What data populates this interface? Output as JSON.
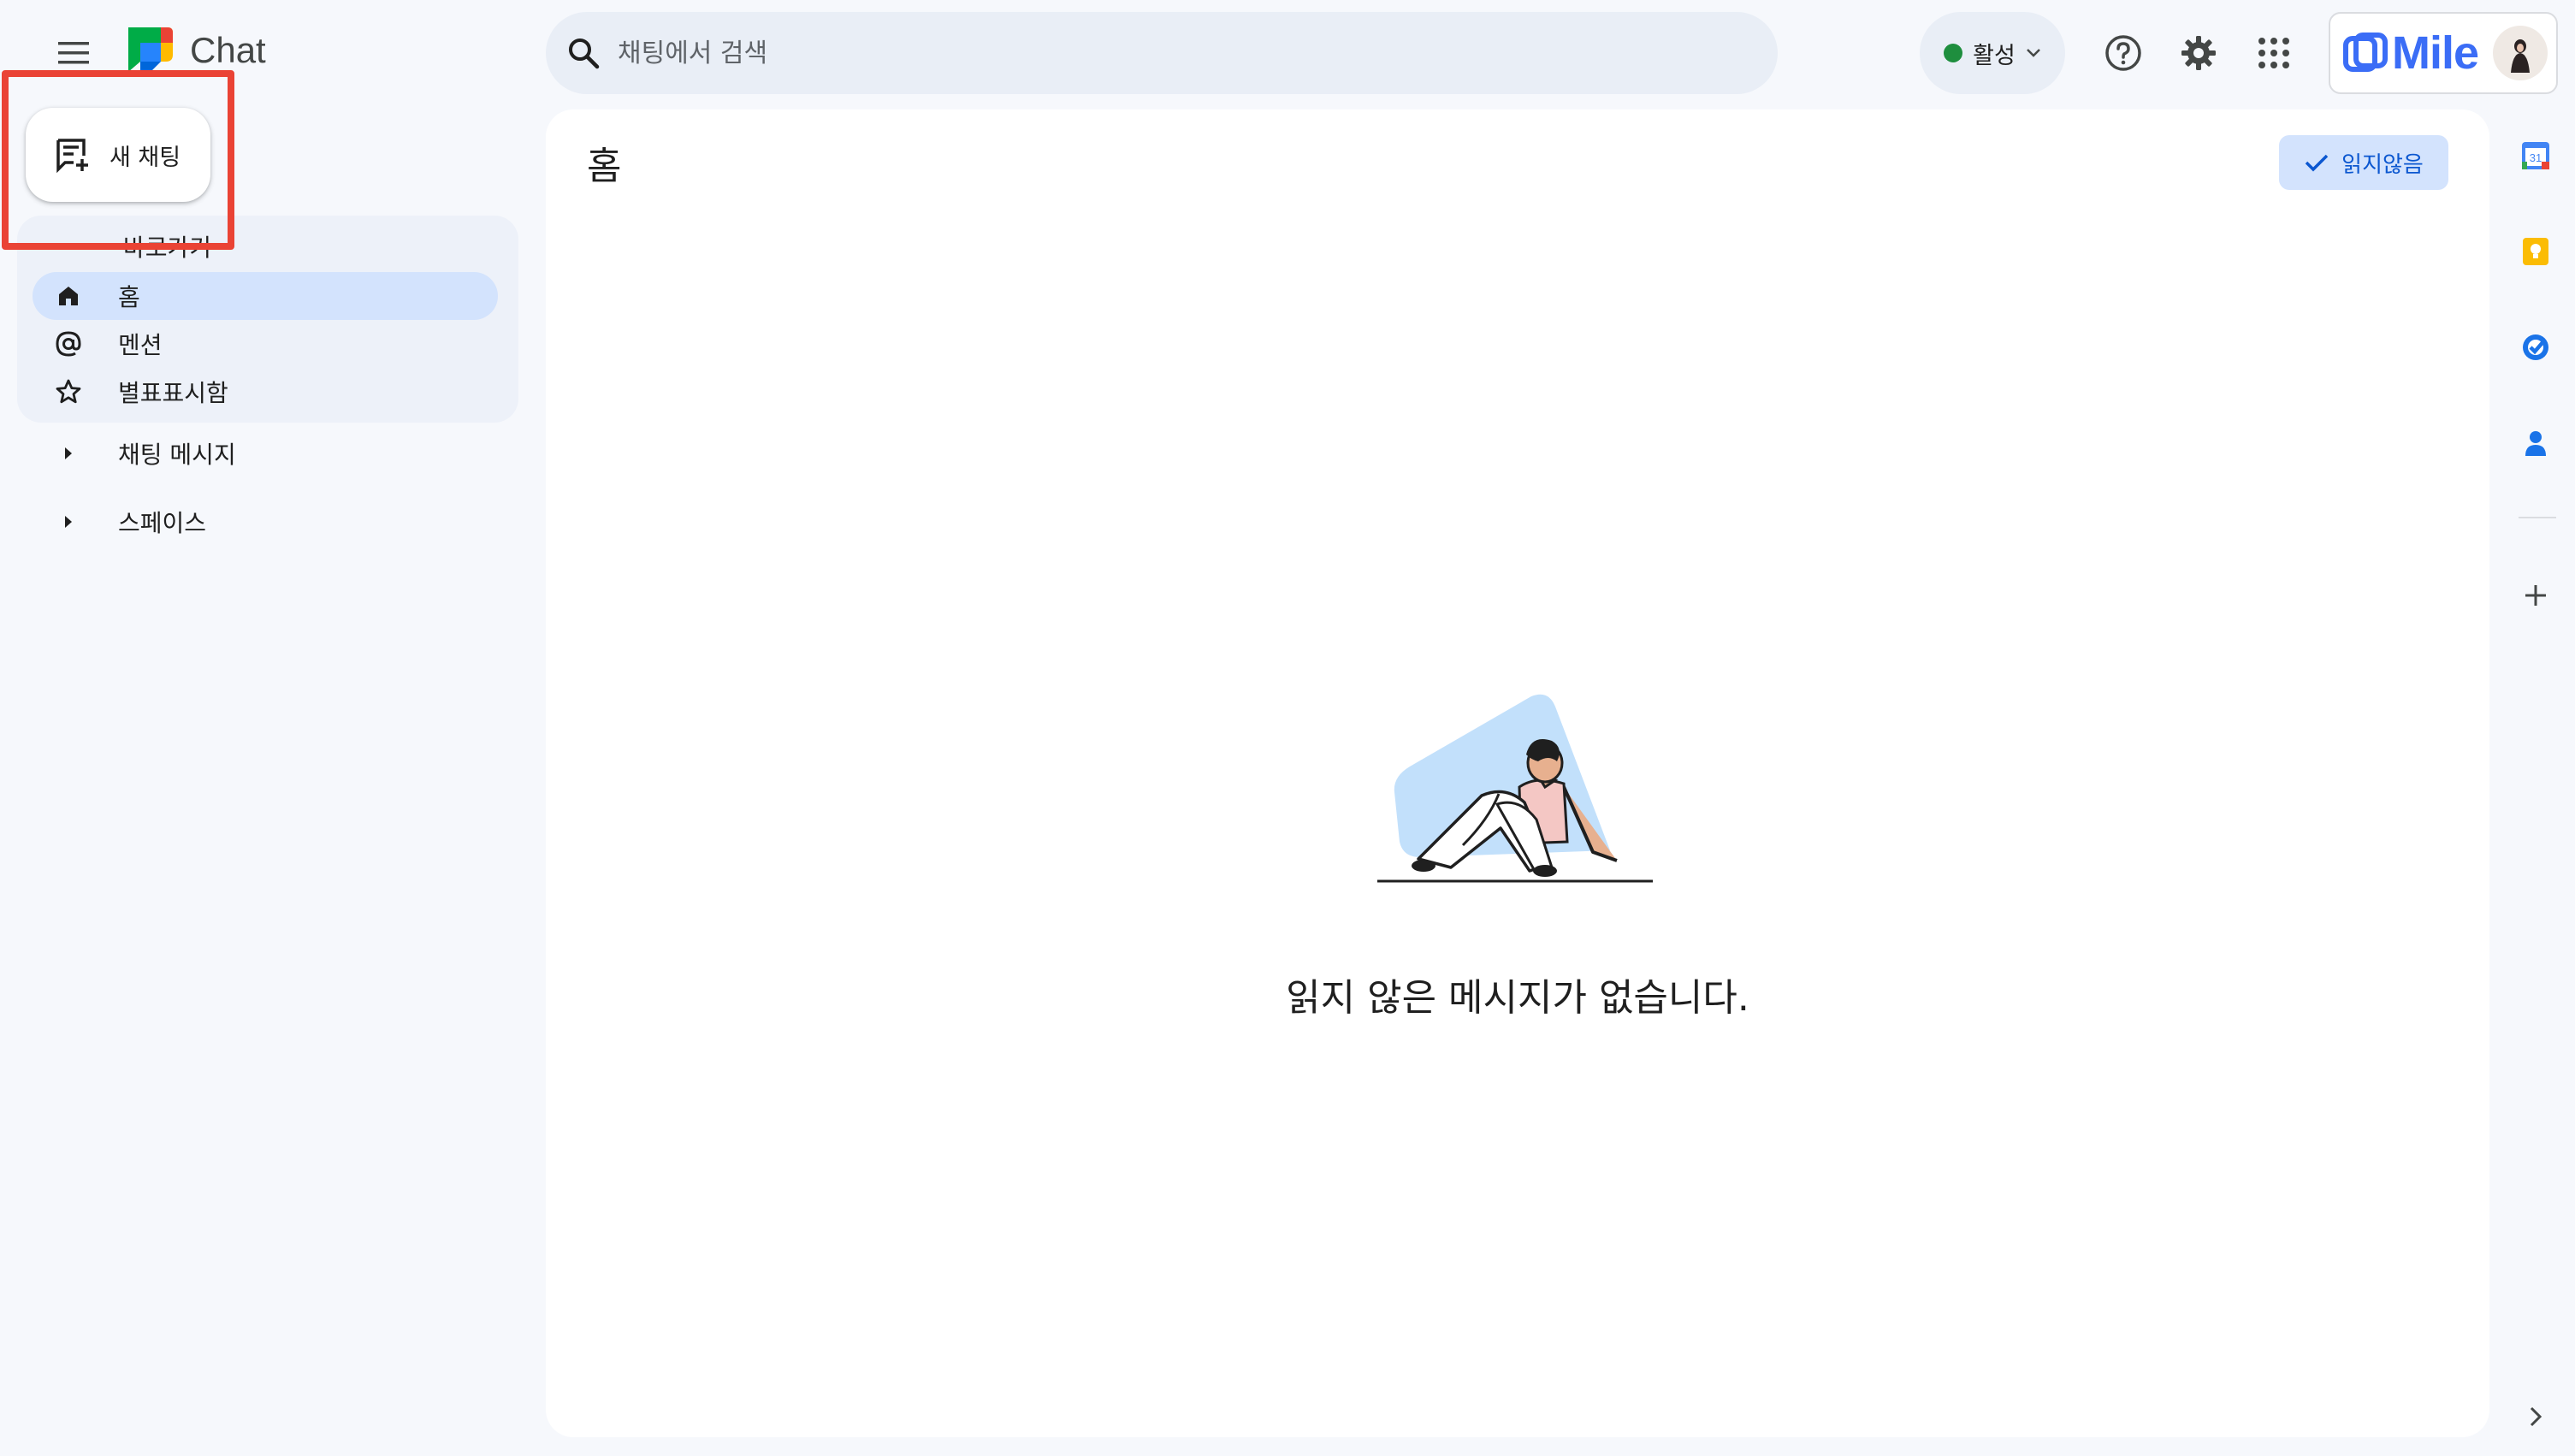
{
  "header": {
    "app_name": "Chat",
    "search_placeholder": "채팅에서 검색",
    "status_label": "활성",
    "account_brand": "Mile"
  },
  "sidebar": {
    "new_chat_label": "새 채팅",
    "shortcuts_title": "바로가기",
    "items": [
      {
        "label": "홈",
        "icon": "home-icon",
        "active": true
      },
      {
        "label": "멘션",
        "icon": "at-sign-icon",
        "active": false
      },
      {
        "label": "별표표시함",
        "icon": "star-icon",
        "active": false
      }
    ],
    "sections": [
      {
        "label": "채팅 메시지"
      },
      {
        "label": "스페이스"
      }
    ]
  },
  "main": {
    "title": "홈",
    "unread_filter_label": "읽지않음",
    "empty_message": "읽지 않은 메시지가 없습니다."
  },
  "right_rail": {
    "calendar_day": "31",
    "apps": [
      "calendar-icon",
      "keep-icon",
      "tasks-icon",
      "contacts-icon",
      "add-icon"
    ]
  },
  "colors": {
    "accent": "#0b57d0",
    "active_nav_bg": "#d3e3fd",
    "status_green": "#1e8e3e",
    "highlight_red": "#ea4335",
    "mile_blue": "#3b6df6"
  }
}
